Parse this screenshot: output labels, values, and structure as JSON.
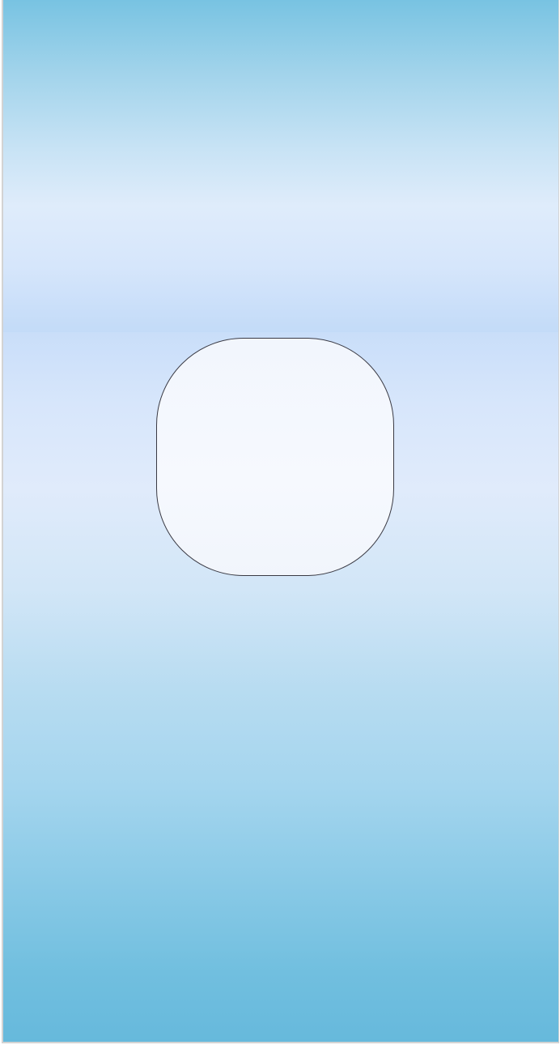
{
  "screen": {
    "colors": {
      "top_panel_top": "#78c3e2",
      "top_panel_middle": "#dfecfb",
      "top_panel_bottom": "#c3dbf8",
      "bottom_panel_top": "#c9def9",
      "bottom_panel_bottom": "#66b9dc",
      "box_fill": "#f4f8fe",
      "box_border": "#3a3a44"
    }
  }
}
